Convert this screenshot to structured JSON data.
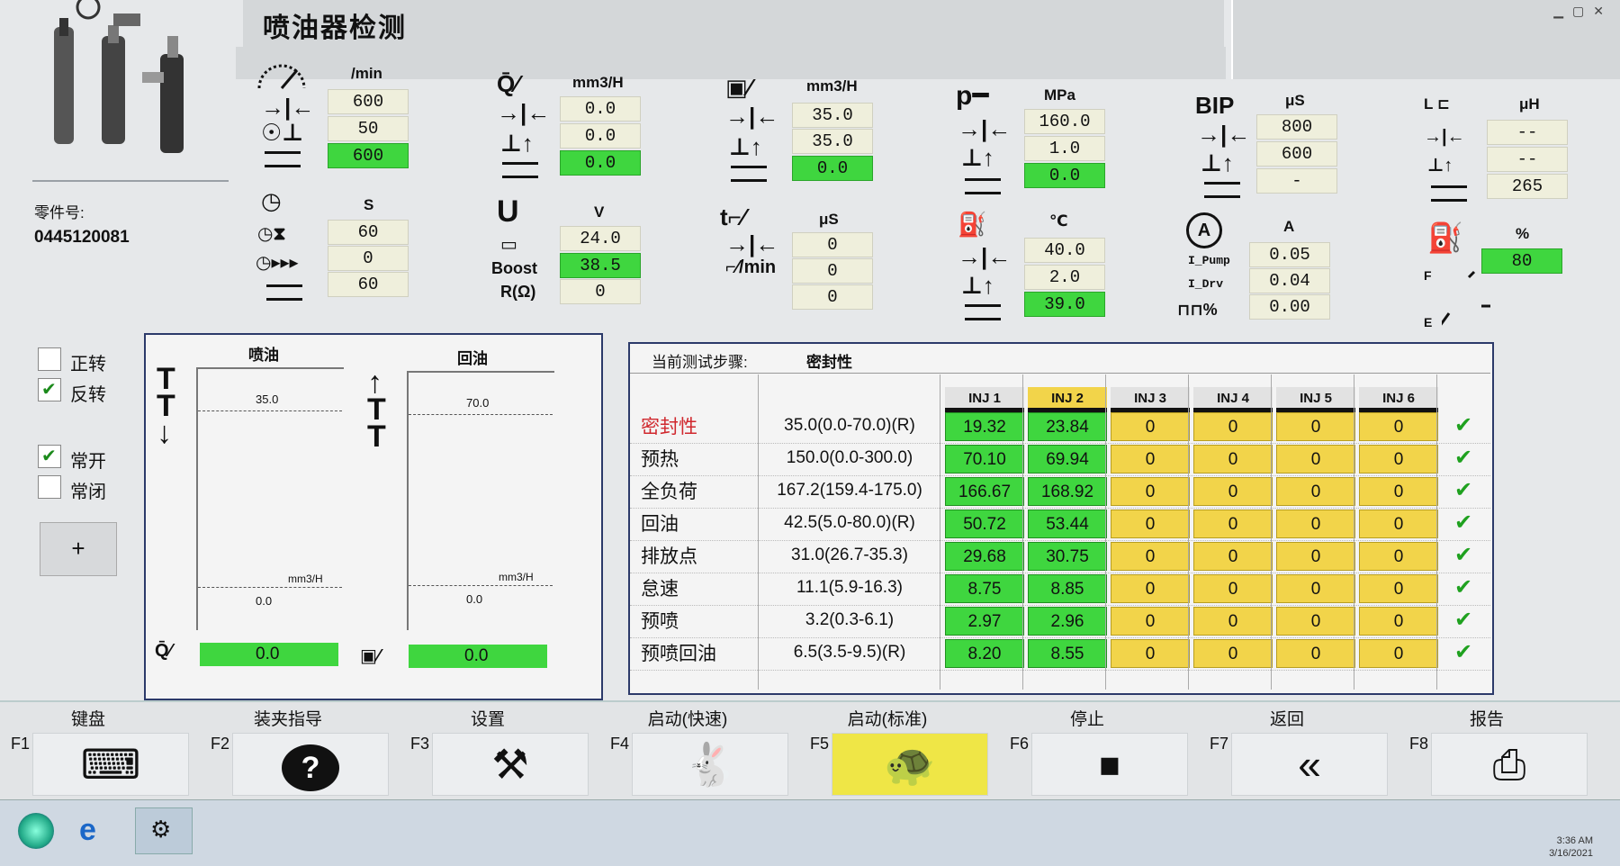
{
  "title": "喷油器检测",
  "part": {
    "label": "零件号:",
    "value": "0445120081"
  },
  "params": {
    "speed": {
      "unit": "/min",
      "set": "600",
      "tol": "50",
      "actual": "600"
    },
    "time": {
      "unit": "S",
      "set": "60",
      "tol": "0",
      "actual": "60"
    },
    "inj_qty": {
      "unit": "mm3/H",
      "set": "0.0",
      "tol": "0.0",
      "actual": "0.0"
    },
    "volt": {
      "unit": "V",
      "boost_label": "Boost",
      "r_label": "R(Ω)",
      "set": "24.0",
      "boost": "38.5",
      "r": "0"
    },
    "ret_qty": {
      "unit": "mm3/H",
      "set": "35.0",
      "tol": "35.0",
      "actual": "0.0"
    },
    "pulse": {
      "unit": "μS",
      "min_label": "/min",
      "v1": "0",
      "v2": "0",
      "v3": "0"
    },
    "pressure": {
      "unit": "MPa",
      "set": "160.0",
      "tol": "1.0",
      "actual": "0.0"
    },
    "temp": {
      "unit": "℃",
      "set": "40.0",
      "tol": "2.0",
      "actual": "39.0"
    },
    "bip": {
      "label": "BIP",
      "unit": "μS",
      "set": "800",
      "tol": "600",
      "actual": "-"
    },
    "current": {
      "unit": "A",
      "pump_label": "I_Pump",
      "drv_label": "I_Drv",
      "pwm_label": "%",
      "pump": "0.05",
      "drv": "0.04",
      "pwm": "0.00"
    },
    "induct": {
      "unit": "μH",
      "set": "--",
      "tol": "--",
      "actual": "265"
    },
    "fuel": {
      "unit": "%",
      "value": "80",
      "f_label": "F",
      "e_label": "E",
      "level_pct": 80
    }
  },
  "options": {
    "fwd": "正转",
    "rev": "反转",
    "no": "常开",
    "nc": "常闭",
    "plus": "+"
  },
  "gauge": {
    "inj_title": "喷油",
    "ret_title": "回油",
    "inj_max": "35.0",
    "ret_max": "70.0",
    "inj_min": "0.0",
    "ret_min": "0.0",
    "unit": "mm3/H",
    "inj_val": "0.0",
    "ret_val": "0.0"
  },
  "table": {
    "step_label": "当前测试步骤:",
    "step_value": "密封性",
    "headers": [
      "INJ 1",
      "INJ 2",
      "INJ 3",
      "INJ 4",
      "INJ 5",
      "INJ 6"
    ],
    "rows": [
      {
        "name": "密封性",
        "range": "35.0(0.0-70.0)(R)",
        "v": [
          "19.32",
          "23.84",
          "0",
          "0",
          "0",
          "0"
        ]
      },
      {
        "name": "预热",
        "range": "150.0(0.0-300.0)",
        "v": [
          "70.10",
          "69.94",
          "0",
          "0",
          "0",
          "0"
        ]
      },
      {
        "name": "全负荷",
        "range": "167.2(159.4-175.0)",
        "v": [
          "166.67",
          "168.92",
          "0",
          "0",
          "0",
          "0"
        ]
      },
      {
        "name": "回油",
        "range": "42.5(5.0-80.0)(R)",
        "v": [
          "50.72",
          "53.44",
          "0",
          "0",
          "0",
          "0"
        ]
      },
      {
        "name": "排放点",
        "range": "31.0(26.7-35.3)",
        "v": [
          "29.68",
          "30.75",
          "0",
          "0",
          "0",
          "0"
        ]
      },
      {
        "name": "怠速",
        "range": "11.1(5.9-16.3)",
        "v": [
          "8.75",
          "8.85",
          "0",
          "0",
          "0",
          "0"
        ]
      },
      {
        "name": "预喷",
        "range": "3.2(0.3-6.1)",
        "v": [
          "2.97",
          "2.96",
          "0",
          "0",
          "0",
          "0"
        ]
      },
      {
        "name": "预喷回油",
        "range": "6.5(3.5-9.5)(R)",
        "v": [
          "8.20",
          "8.55",
          "0",
          "0",
          "0",
          "0"
        ]
      }
    ]
  },
  "fkeys": [
    {
      "fn": "F1",
      "label": "键盘",
      "icon": "keyboard-icon"
    },
    {
      "fn": "F2",
      "label": "装夹指导",
      "icon": "help-icon"
    },
    {
      "fn": "F3",
      "label": "设置",
      "icon": "tools-icon"
    },
    {
      "fn": "F4",
      "label": "启动(快速)",
      "icon": "rabbit-icon"
    },
    {
      "fn": "F5",
      "label": "启动(标准)",
      "icon": "turtle-icon"
    },
    {
      "fn": "F6",
      "label": "停止",
      "icon": "stop-icon"
    },
    {
      "fn": "F7",
      "label": "返回",
      "icon": "back-icon"
    },
    {
      "fn": "F8",
      "label": "报告",
      "icon": "printer-icon"
    }
  ],
  "clock": {
    "time": "3:36 AM",
    "date": "3/16/2021"
  },
  "colors": {
    "green": "#3fd63f",
    "yellow": "#f2d44a",
    "active_fkey": "#efe646"
  }
}
